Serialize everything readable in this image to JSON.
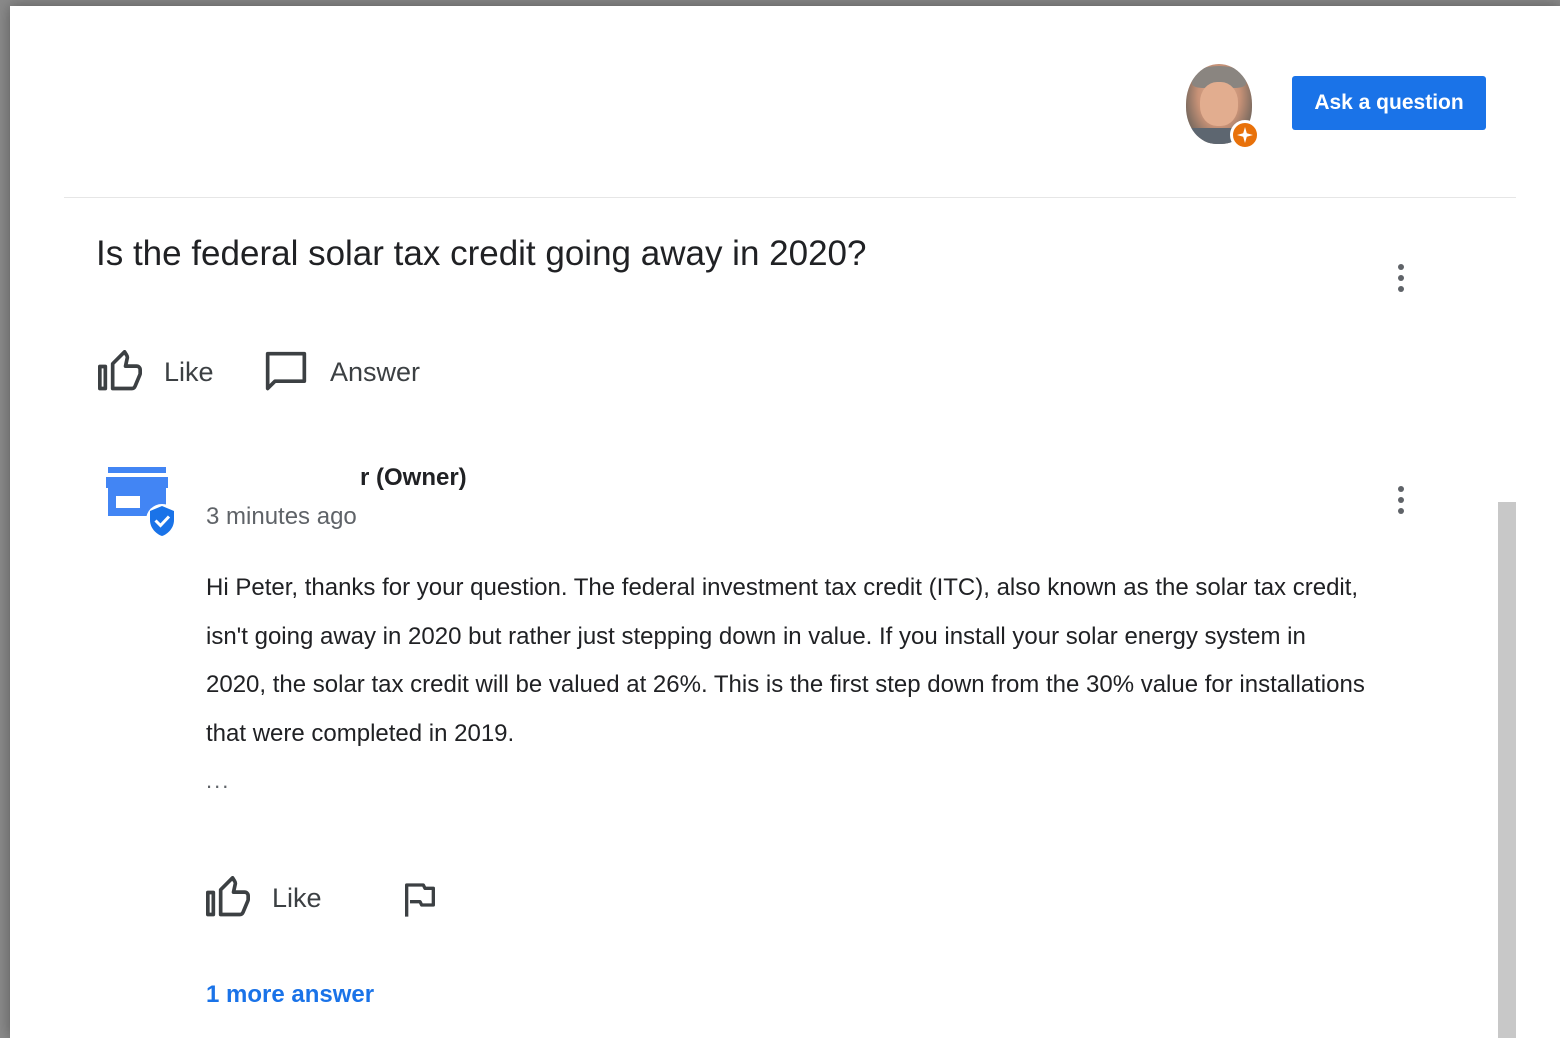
{
  "header": {
    "ask_button_label": "Ask a question",
    "avatar_icon": "user-avatar",
    "badge_icon": "local-guide-star-icon",
    "badge_color": "#e8710a"
  },
  "question": {
    "title": "Is the federal solar tax credit going away in 2020?",
    "actions": {
      "like_label": "Like",
      "answer_label": "Answer"
    }
  },
  "answer": {
    "author": "r (Owner)",
    "author_icon": "verified-store-icon",
    "timestamp": "3 minutes ago",
    "body": "Hi Peter, thanks for your question. The federal investment tax credit (ITC), also known as the solar tax credit, isn't going away in 2020 but rather just stepping down in value. If you install your solar energy system in 2020, the solar tax credit will be valued at 26%. This is the first step down from the 30% value for installations that were completed in 2019.",
    "truncation": "...",
    "actions": {
      "like_label": "Like",
      "flag_icon": "flag-icon"
    },
    "more_answers_link": "1 more answer"
  },
  "colors": {
    "accent": "#1a73e8",
    "text": "#202124",
    "secondary_text": "#5f6368"
  }
}
